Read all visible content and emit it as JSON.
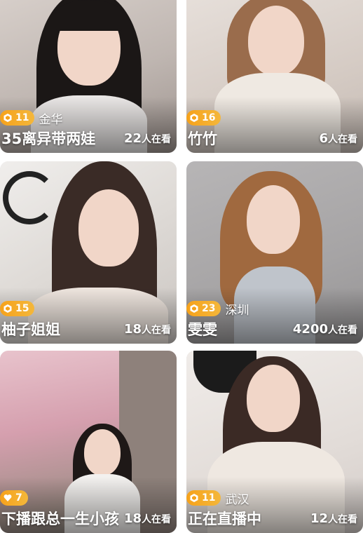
{
  "feed": {
    "items": [
      {
        "level": "11",
        "city": "金华",
        "name": "35离异带两娃",
        "viewers": "22",
        "viewers_suffix": "人在看",
        "level_color": "#f6a21b",
        "bg": "#cfc7c2"
      },
      {
        "level": "16",
        "city": "",
        "name": "竹竹",
        "viewers": "6",
        "viewers_suffix": "人在看",
        "level_color": "#f6a21b",
        "bg": "#d7cfc8"
      },
      {
        "level": "15",
        "city": "",
        "name": "柚子姐姐",
        "viewers": "18",
        "viewers_suffix": "人在看",
        "level_color": "#f6a21b",
        "bg": "#e4e1de"
      },
      {
        "level": "23",
        "city": "深圳",
        "name": "雯雯",
        "viewers": "4200",
        "viewers_suffix": "人在看",
        "level_color": "#f6a21b",
        "bg": "#a9a7a8"
      },
      {
        "level": "7",
        "city": "",
        "name": "下播跟总一生小孩",
        "viewers": "18",
        "viewers_suffix": "人在看",
        "level_color": "#f6a21b",
        "bg": "#d9aab5"
      },
      {
        "level": "11",
        "city": "武汉",
        "name": "正在直播中",
        "viewers": "12",
        "viewers_suffix": "人在看",
        "level_color": "#f6a21b",
        "bg": "#e8e3e0"
      }
    ]
  }
}
